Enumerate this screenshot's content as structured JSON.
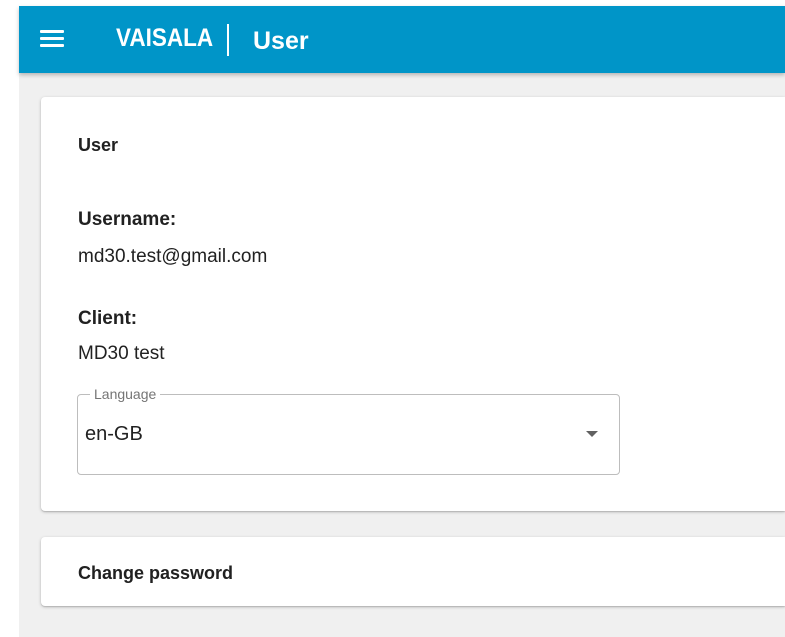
{
  "appbar": {
    "logo_text": "VAISALA",
    "title": "User",
    "background": "#0095c8",
    "menu_icon": "hamburger-menu-icon"
  },
  "user_card": {
    "title": "User",
    "username_label": "Username:",
    "username_value": "md30.test@gmail.com",
    "client_label": "Client:",
    "client_value": "MD30 test",
    "language": {
      "label": "Language",
      "value": "en-GB",
      "dropdown_icon": "caret-down-icon"
    }
  },
  "password_card": {
    "title": "Change password"
  }
}
